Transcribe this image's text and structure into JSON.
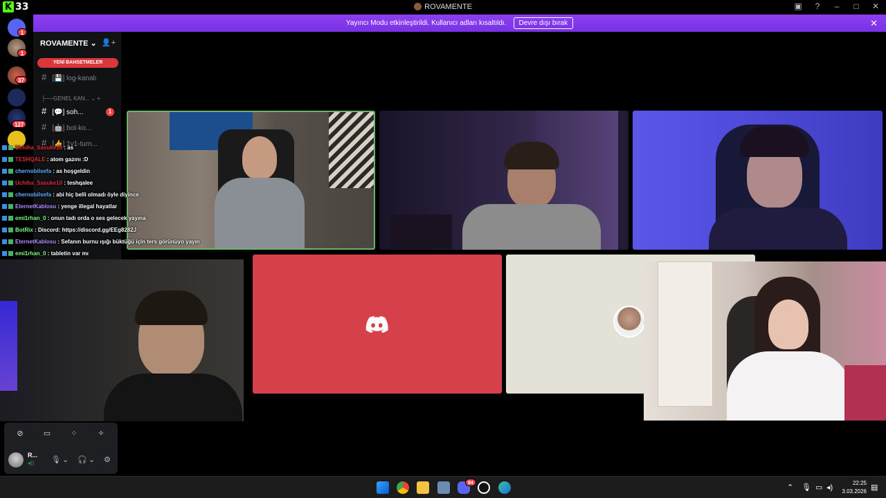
{
  "app": {
    "logo_letter": "K",
    "logo_number": "33",
    "window_title": "ROVAMENTE"
  },
  "banner": {
    "text": "Yayıncı Modu etkinleştirildi. Kullanıcı adları kısaltıldı.",
    "button": "Devre dışı bırak"
  },
  "guilds": [
    {
      "badge": "1"
    },
    {
      "badge": "1"
    },
    {
      "badge": "37"
    },
    {
      "badge": ""
    },
    {
      "badge": "127"
    },
    {
      "badge": ""
    }
  ],
  "server": {
    "name": "ROVAMENTE",
    "new_mentions": "YENİ BAHSETMELER",
    "channels": [
      {
        "emoji": "💾",
        "name": "log-kanalı"
      },
      {
        "emoji": "💬",
        "name": "soh...",
        "badge": "1"
      },
      {
        "emoji": "🤖",
        "name": "bot-ko..."
      },
      {
        "emoji": "👍",
        "name": "1v1-turn..."
      }
    ],
    "category": "GENEL KAN..."
  },
  "chat": [
    {
      "user": "Uchiha_Sasuke10",
      "color": "#e0293b",
      "text": "as"
    },
    {
      "user": "TESHQALE",
      "color": "#e0293b",
      "text": "atom gazını :D"
    },
    {
      "user": "chernobilsefa",
      "color": "#5fb0ff",
      "text": "as hoşgeldin"
    },
    {
      "user": "Uchiha_Sasuke10",
      "color": "#e0293b",
      "text": "teshqalee"
    },
    {
      "user": "chernobilsefa",
      "color": "#5fb0ff",
      "text": "abi hiç belli olmadı öyle diyince"
    },
    {
      "user": "EternetKablosu",
      "color": "#b48cff",
      "text": "yenge illegal hayatlar"
    },
    {
      "user": "emi1rhan_0",
      "color": "#7cff7c",
      "text": "onun tadı orda o ses gelecek yayına"
    },
    {
      "user": "BotRix",
      "color": "#7cff7c",
      "text": "Discord: https://discord.gg/EEg8282J"
    },
    {
      "user": "EternetKablosu",
      "color": "#b48cff",
      "text": "Sefanın burnu ışığı büktüğü için ters görünüyo yayın"
    },
    {
      "user": "emi1rhan_0",
      "color": "#7cff7c",
      "text": "tabletin var mı"
    }
  ],
  "user_panel": {
    "name": "R..."
  },
  "clock": {
    "time": "22:25",
    "date": "3.03.2026"
  },
  "taskbar": {
    "discord_badge": "84"
  }
}
